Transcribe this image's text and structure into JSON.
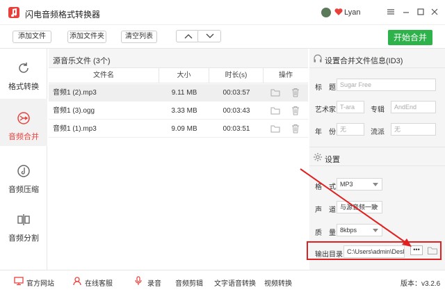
{
  "app": {
    "title": "闪电音频格式转换器",
    "username": "Lyan",
    "version": "版本：v3.2.6"
  },
  "colors": {
    "accent": "#e8413c",
    "green": "#2db34a",
    "highlight": "#e02020"
  },
  "toolbar": {
    "add_file": "添加文件",
    "add_folder": "添加文件夹",
    "clear_list": "清空列表",
    "start": "开始合并"
  },
  "sidebar": {
    "items": [
      {
        "label": "格式转换",
        "icon": "refresh-icon"
      },
      {
        "label": "音频合并",
        "icon": "merge-icon"
      },
      {
        "label": "音频压缩",
        "icon": "disc-icon"
      },
      {
        "label": "音频分割",
        "icon": "split-icon"
      }
    ]
  },
  "list": {
    "header": "源音乐文件 (3个)",
    "columns": [
      "文件名",
      "大小",
      "时长(s)",
      "操作"
    ],
    "rows": [
      {
        "name": "音频1 (2).mp3",
        "size": "9.11 MB",
        "duration": "00:03:57"
      },
      {
        "name": "音频1 (3).ogg",
        "size": "3.33 MB",
        "duration": "00:03:43"
      },
      {
        "name": "音频1 (1).mp3",
        "size": "9.09 MB",
        "duration": "00:03:51"
      }
    ]
  },
  "id3": {
    "header": "设置合并文件信息(ID3)",
    "title_label": "标　题",
    "title_placeholder": "Sugar Free",
    "artist_label": "艺术家",
    "artist_placeholder": "T-ara",
    "album_label": "专辑",
    "album_placeholder": "AndEnd",
    "year_label": "年　份",
    "year_placeholder": "无",
    "genre_label": "流派",
    "genre_placeholder": "无"
  },
  "settings": {
    "header": "设置",
    "format_label": "格　式",
    "format_value": "MP3",
    "channel_label": "声　道",
    "channel_value": "与源音频一致",
    "quality_label": "质　量",
    "quality_value": "8kbps",
    "output_label": "输出目录",
    "output_value": "C:\\Users\\admin\\Desktop",
    "dots": "•••"
  },
  "bottom": {
    "website": "官方网站",
    "service": "在线客服",
    "record": "录音",
    "audio_edit": "音频剪辑",
    "tts": "文字语音转换",
    "video": "视频转换"
  }
}
